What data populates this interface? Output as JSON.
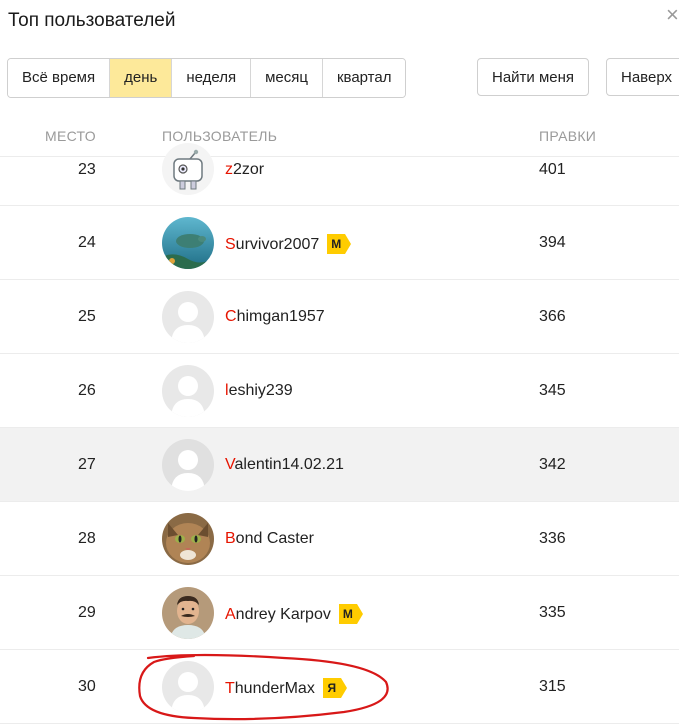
{
  "header": {
    "title": "Топ пользователей",
    "close_glyph": "×"
  },
  "period_tabs": [
    {
      "label": "Всё время",
      "active": false
    },
    {
      "label": "день",
      "active": true
    },
    {
      "label": "неделя",
      "active": false
    },
    {
      "label": "месяц",
      "active": false
    },
    {
      "label": "квартал",
      "active": false
    }
  ],
  "actions": {
    "find_me": "Найти меня",
    "to_top": "Наверх"
  },
  "columns": {
    "place": "МЕСТО",
    "user": "ПОЛЬЗОВАТЕЛЬ",
    "edits": "ПРАВКИ"
  },
  "rows": [
    {
      "place": "23",
      "name_first": "z",
      "name_rest": "2zor",
      "edits": "401",
      "avatar": "robot-cartoon-icon",
      "badge": ""
    },
    {
      "place": "24",
      "name_first": "S",
      "name_rest": "urvivor2007",
      "edits": "394",
      "avatar": "sea-turtle-photo",
      "badge": "М"
    },
    {
      "place": "25",
      "name_first": "C",
      "name_rest": "himgan1957",
      "edits": "366",
      "avatar": "default-user-icon",
      "badge": ""
    },
    {
      "place": "26",
      "name_first": "l",
      "name_rest": "eshiy239",
      "edits": "345",
      "avatar": "default-user-icon",
      "badge": ""
    },
    {
      "place": "27",
      "name_first": "V",
      "name_rest": "alentin14.02.21",
      "edits": "342",
      "avatar": "default-user-icon",
      "badge": "",
      "highlighted": true
    },
    {
      "place": "28",
      "name_first": "B",
      "name_rest": "ond Caster",
      "edits": "336",
      "avatar": "cat-photo",
      "badge": ""
    },
    {
      "place": "29",
      "name_first": "A",
      "name_rest": "ndrey Karpov",
      "edits": "335",
      "avatar": "man-mustache-photo",
      "badge": "М"
    },
    {
      "place": "30",
      "name_first": "T",
      "name_rest": "hunderMax",
      "edits": "315",
      "avatar": "default-user-icon",
      "badge": "Я"
    }
  ],
  "colors": {
    "active_tab": "#fde99a",
    "badge": "#ffcc00",
    "name_first_letter": "#e61400",
    "annotation": "#d81818"
  }
}
